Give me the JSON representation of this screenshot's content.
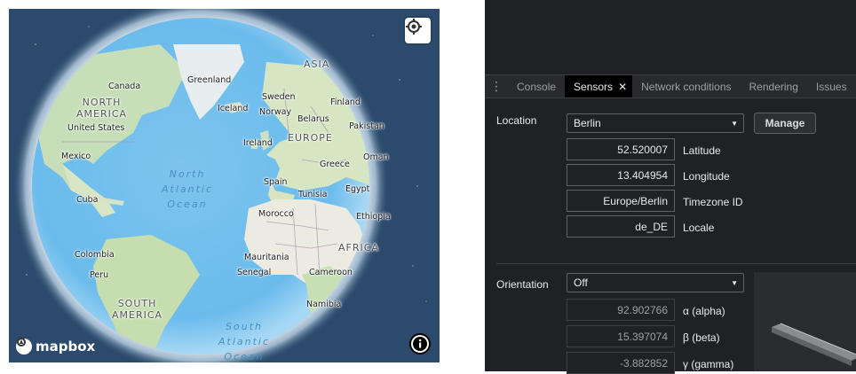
{
  "map": {
    "labels": {
      "asia": "ASIA",
      "canada": "Canada",
      "greenland": "Greenland",
      "north_america": "NORTH\nAMERICA",
      "sweden": "Sweden",
      "iceland": "Iceland",
      "norway": "Norway",
      "finland": "Finland",
      "belarus": "Belarus",
      "united_states": "United States",
      "pakistan": "Pakistan",
      "ireland": "Ireland",
      "europe": "EUROPE",
      "mexico": "Mexico",
      "oman": "Oman",
      "north_atlantic_ocean": "North\nAtlantic\nOcean",
      "greece": "Greece",
      "spain": "Spain",
      "egypt": "Egypt",
      "tunisia": "Tunisia",
      "cuba": "Cuba",
      "morocco": "Morocco",
      "ethiopia": "Ethiopia",
      "africa": "AFRICA",
      "colombia": "Colombia",
      "mauritania": "Mauritania",
      "senegal": "Senegal",
      "cameroon": "Cameroon",
      "peru": "Peru",
      "south_america": "SOUTH\nAMERICA",
      "namibia": "Namibia",
      "south_atlantic_ocean": "South\nAtlantic\nOcean"
    },
    "logo_text": "mapbox",
    "controls": {
      "locate_icon": "crosshair-icon",
      "info_icon": "info-icon"
    }
  },
  "devtools": {
    "tabs": [
      {
        "label": "Console",
        "active": false
      },
      {
        "label": "Sensors",
        "active": true
      },
      {
        "label": "Network conditions",
        "active": false
      },
      {
        "label": "Rendering",
        "active": false
      },
      {
        "label": "Issues",
        "active": false
      }
    ],
    "location": {
      "label": "Location",
      "selected": "Berlin",
      "manage_label": "Manage",
      "latitude": "52.520007",
      "latitude_label": "Latitude",
      "longitude": "13.404954",
      "longitude_label": "Longitude",
      "timezone": "Europe/Berlin",
      "timezone_label": "Timezone ID",
      "locale": "de_DE",
      "locale_label": "Locale"
    },
    "orientation": {
      "label": "Orientation",
      "selected": "Off",
      "alpha": "92.902766",
      "alpha_label": "α (alpha)",
      "beta": "15.397074",
      "beta_label": "β (beta)",
      "gamma": "-3.882852",
      "gamma_label": "γ (gamma)"
    }
  }
}
